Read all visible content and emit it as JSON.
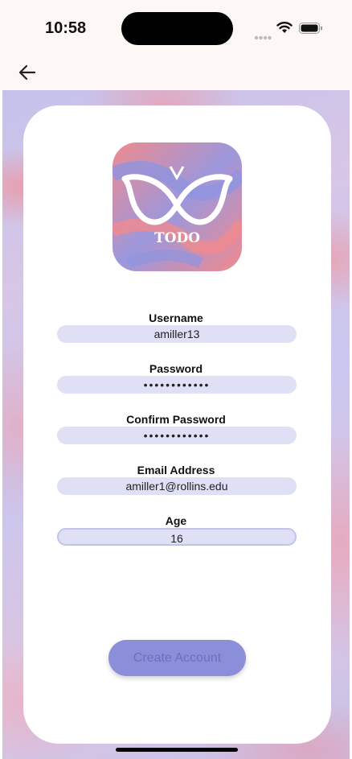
{
  "status_bar": {
    "time": "10:58"
  },
  "form": {
    "username": {
      "label": "Username",
      "value": "amiller13"
    },
    "password": {
      "label": "Password",
      "value": "••••••••••••"
    },
    "confirm_password": {
      "label": "Confirm Password",
      "value": "••••••••••••"
    },
    "email": {
      "label": "Email Address",
      "value": "amiller1@rollins.edu"
    },
    "age": {
      "label": "Age",
      "value": "16"
    }
  },
  "logo": {
    "text": "TODO",
    "icon": "butterfly-icon"
  },
  "actions": {
    "create_account_label": "Create Account"
  },
  "colors": {
    "accent": "#8b8fd9",
    "field_bg": "#dfe0f5",
    "logo_pink": "#f08a8e",
    "logo_blue": "#8f94e0"
  },
  "icons": [
    "back-arrow-icon",
    "signal-icon",
    "wifi-icon",
    "battery-icon"
  ]
}
